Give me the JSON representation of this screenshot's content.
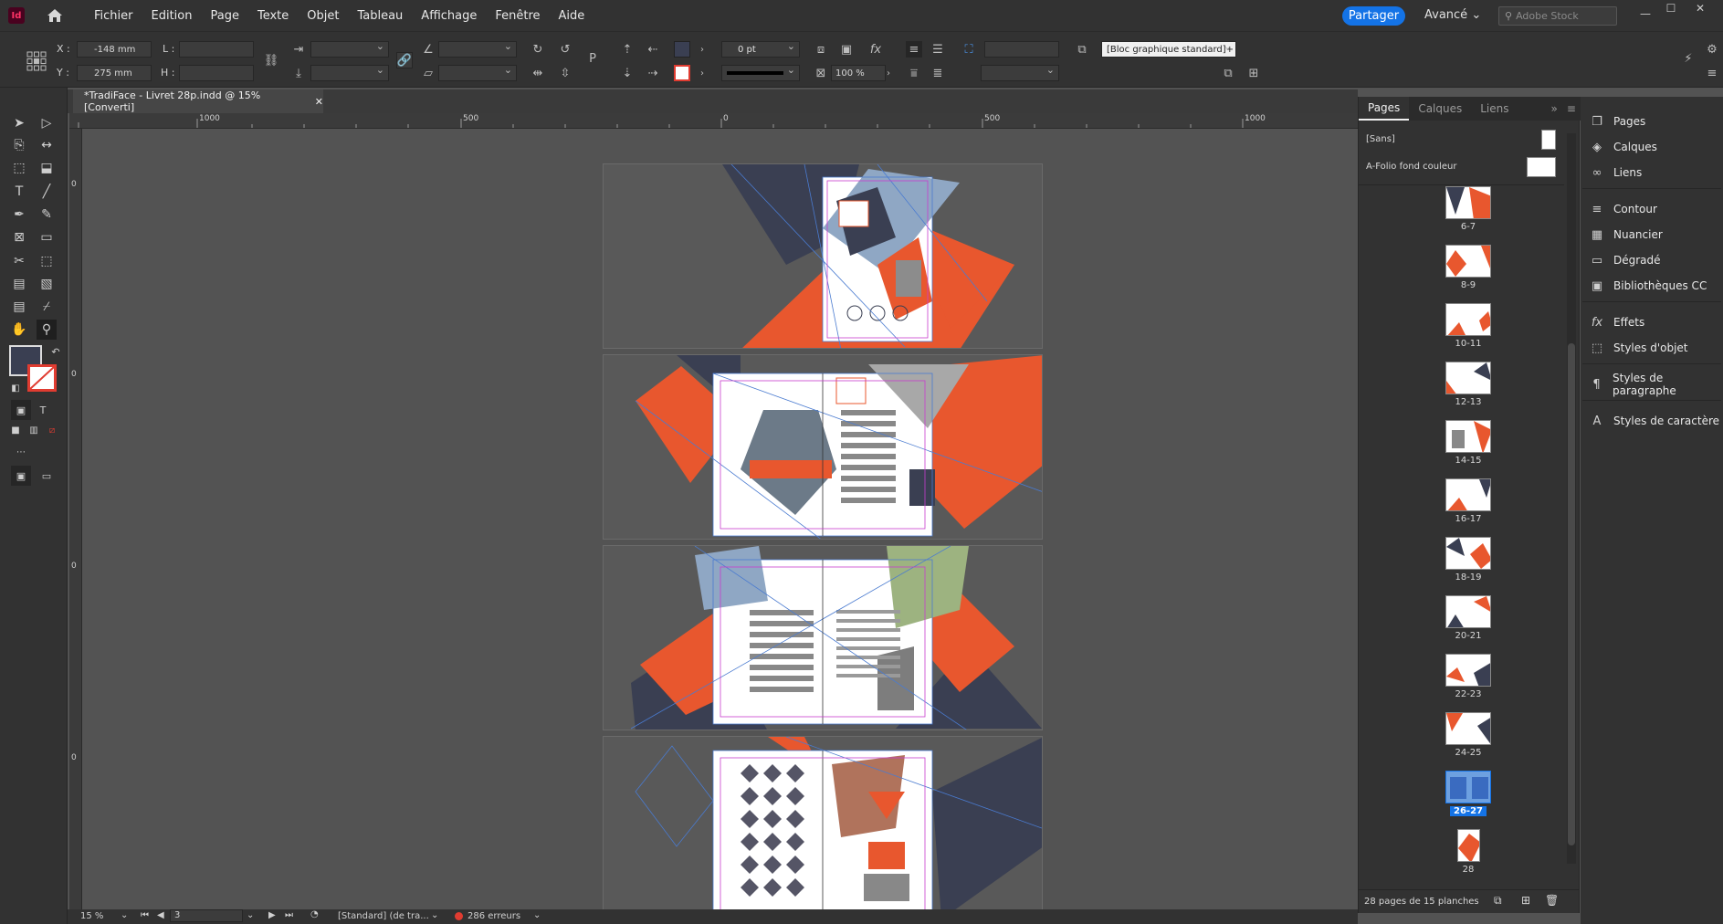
{
  "menubar": {
    "app_logo": "Id",
    "items": [
      "Fichier",
      "Edition",
      "Page",
      "Texte",
      "Objet",
      "Tableau",
      "Affichage",
      "Fenêtre",
      "Aide"
    ],
    "share_label": "Partager",
    "workspace_label": "Avancé",
    "stock_placeholder": "Adobe Stock"
  },
  "control": {
    "x_label": "X :",
    "x_value": "-148 mm",
    "y_label": "Y :",
    "y_value": "275 mm",
    "w_label": "L :",
    "h_label": "H :",
    "stroke_weight": "0 pt",
    "scale": "100 %",
    "object_style": "[Bloc graphique standard]+"
  },
  "document": {
    "tab_title": "*TradiFace - Livret 28p.indd @ 15% [Converti]"
  },
  "rulers": {
    "h_labels": [
      "1000",
      "500",
      "0",
      "500",
      "1000"
    ],
    "v_labels": [
      "0",
      "0",
      "0",
      "0"
    ]
  },
  "pages_panel": {
    "tabs": [
      "Pages",
      "Calques",
      "Liens"
    ],
    "masters": [
      "[Sans]",
      "A-Folio fond couleur"
    ],
    "spreads": [
      "6-7",
      "8-9",
      "10-11",
      "12-13",
      "14-15",
      "16-17",
      "18-19",
      "20-21",
      "22-23",
      "24-25",
      "26-27",
      "28"
    ],
    "selected_spread": "26-27",
    "footer": "28 pages de 15 planches"
  },
  "right_dock": {
    "items": [
      "Pages",
      "Calques",
      "Liens",
      "Contour",
      "Nuancier",
      "Dégradé",
      "Bibliothèques CC",
      "Effets",
      "Styles d'objet",
      "Styles de paragraphe",
      "Styles de caractère"
    ],
    "icons": [
      "pages-icon",
      "layers-icon",
      "links-icon",
      "stroke-icon",
      "swatches-icon",
      "gradient-icon",
      "cc-libraries-icon",
      "effects-icon",
      "object-styles-icon",
      "paragraph-styles-icon",
      "character-styles-icon"
    ]
  },
  "status": {
    "zoom": "15 %",
    "page": "3",
    "preflight_profile": "[Standard] (de tra...",
    "errors": "286 erreurs"
  },
  "colors": {
    "accent": "#1473e6",
    "orange": "#e8572e",
    "navy": "#3a3f52",
    "error": "#e03c31"
  }
}
